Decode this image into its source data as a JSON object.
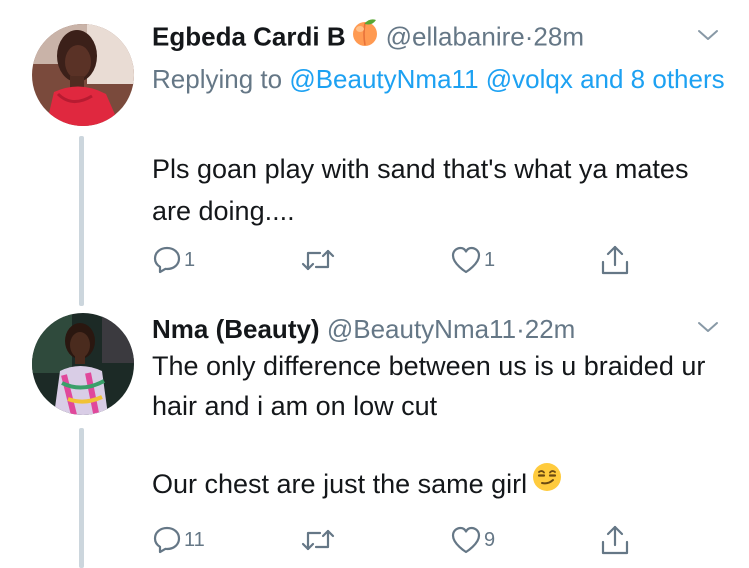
{
  "tweets": [
    {
      "display_name": "Egbeda Cardi B",
      "name_emoji": "peach-emoji",
      "handle": "@ellabanire",
      "separator": "·",
      "time": "28m",
      "reply_prefix": "Replying to",
      "reply_targets": "@BeautyNma11 @volqx and 8 others",
      "paragraphs": [
        "Pls goan play with sand that's what ya mates are doing...."
      ],
      "reply_count": "1",
      "retweet_count": "",
      "like_count": "1"
    },
    {
      "display_name": "Nma (Beauty)",
      "handle": "@BeautyNma11",
      "separator": "·",
      "time": "22m",
      "paragraphs": [
        "The only difference between us is u braided ur hair and i am on low cut",
        "Our chest are just the same girl"
      ],
      "trailing_emoji": "smirking-face-emoji",
      "reply_count": "11",
      "retweet_count": "",
      "like_count": "9"
    }
  ],
  "icons": {
    "reply": "speech-bubble-icon",
    "retweet": "retweet-arrows-icon",
    "like": "heart-outline-icon",
    "share": "share-upload-icon",
    "menu": "chevron-down-icon"
  },
  "colors": {
    "primary_text": "#14171a",
    "secondary_text": "#657786",
    "link": "#1da1f2",
    "thread_line": "#ccd6dd",
    "background": "#ffffff"
  }
}
